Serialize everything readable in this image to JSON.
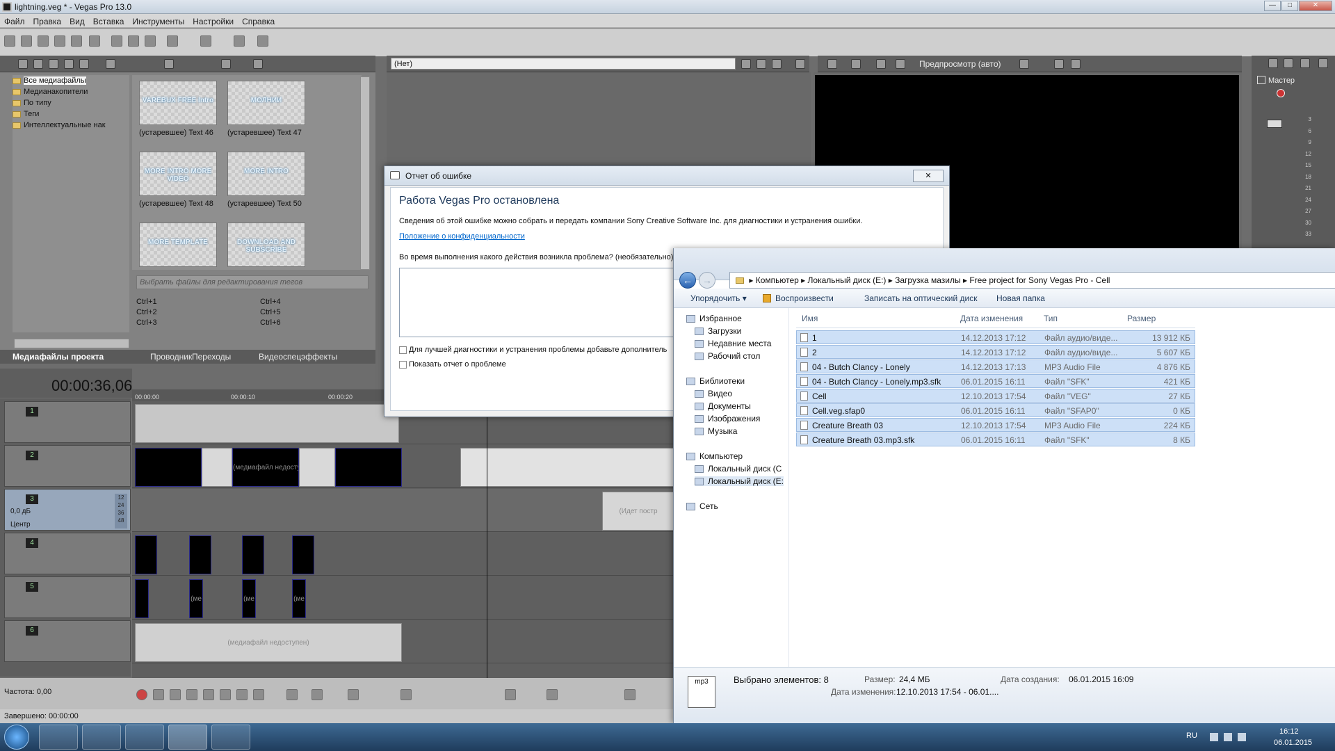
{
  "window": {
    "title": "lightning.veg * - Vegas Pro 13.0",
    "min": "—",
    "max": "□",
    "close": "✕"
  },
  "menu": [
    "Файл",
    "Правка",
    "Вид",
    "Вставка",
    "Инструменты",
    "Настройки",
    "Справка"
  ],
  "media_tree": [
    "Все медиафайлы",
    "Медианакопители",
    "По типу",
    "Теги",
    "Интеллектуальные нак"
  ],
  "thumbnails": [
    {
      "text": "VAREBUX FREE Intro",
      "caption": "(устаревшее) Text 46"
    },
    {
      "text": "МОЛНИИ",
      "caption": "(устаревшее) Text 47"
    },
    {
      "text": "MORE INTRO MORE VIDEO",
      "caption": "(устаревшее) Text 48"
    },
    {
      "text": "MORE INTRO",
      "caption": "(устаревшее) Text 50"
    },
    {
      "text": "MORE TEMPLATE",
      "caption": ""
    },
    {
      "text": "DOWNLOAD AND SUBSCRIBE",
      "caption": ""
    }
  ],
  "tag_placeholder": "Выбрать файлы для редактирования тегов",
  "shortcuts": [
    "Ctrl+1",
    "Ctrl+2",
    "Ctrl+3",
    "Ctrl+4",
    "Ctrl+5",
    "Ctrl+6"
  ],
  "tabs": [
    "Медиафайлы проекта",
    "Проводник",
    "Переходы",
    "Видеоспецэффекты"
  ],
  "fx_select": "(Нет)",
  "preview_label": "Предпросмотр (авто)",
  "mixer_label": "Мастер",
  "mixer_scale": [
    "3",
    "6",
    "9",
    "12",
    "15",
    "18",
    "21",
    "24",
    "27",
    "30",
    "33"
  ],
  "timecode": "00:00:36,06",
  "ruler": [
    "00:00:00",
    "00:00:10",
    "00:00:20"
  ],
  "tracks": [
    "1",
    "2",
    "3",
    "4",
    "5",
    "6"
  ],
  "audio_track": {
    "volume": "0,0 дБ",
    "pan": "Центр",
    "meter": [
      "12",
      "24",
      "36",
      "48"
    ]
  },
  "clip_labels": {
    "unavailable": "(медиафайл недоступен)",
    "building": "(Идет постр",
    "short": "(ме"
  },
  "rate": "Частота: 0,00",
  "status": "Завершено: 00:00:00",
  "dialog": {
    "title": "Отчет об ошибке",
    "heading": "Работа Vegas Pro остановлена",
    "info": "Сведения об этой ошибке можно собрать и передать компании Sony Creative Software Inc. для диагностики и устранения ошибки.",
    "privacy_link": "Положение о конфиденциальности",
    "question": "Во время выполнения какого действия возникла проблема? (необязательно):",
    "check1": "Для лучшей диагностики и устранения проблемы добавьте дополнитель",
    "check2": "Показать отчет о проблеме"
  },
  "explorer": {
    "path": [
      "Компьютер",
      "Локальный диск (E:)",
      "Загрузка мазилы",
      "Free project for Sony Vegas Pro - Cell"
    ],
    "commands": [
      "Упорядочить ▾",
      "Воспроизвести",
      "Записать на оптический диск",
      "Новая папка"
    ],
    "nav": {
      "favorites": "Избранное",
      "fav_items": [
        "Загрузки",
        "Недавние места",
        "Рабочий стол"
      ],
      "libraries": "Библиотеки",
      "lib_items": [
        "Видео",
        "Документы",
        "Изображения",
        "Музыка"
      ],
      "computer": "Компьютер",
      "drives": [
        "Локальный диск (C",
        "Локальный диск (E:"
      ],
      "network": "Сеть"
    },
    "columns": [
      "Имя",
      "Дата изменения",
      "Тип",
      "Размер"
    ],
    "files": [
      {
        "name": "1",
        "date": "14.12.2013 17:12",
        "type": "Файл аудио/виде...",
        "size": "13 912 КБ"
      },
      {
        "name": "2",
        "date": "14.12.2013 17:12",
        "type": "Файл аудио/виде...",
        "size": "5 607 КБ"
      },
      {
        "name": "04 - Butch Clancy - Lonely",
        "date": "14.12.2013 17:13",
        "type": "MP3 Audio File",
        "size": "4 876 КБ"
      },
      {
        "name": "04 - Butch Clancy - Lonely.mp3.sfk",
        "date": "06.01.2015 16:11",
        "type": "Файл \"SFK\"",
        "size": "421 КБ"
      },
      {
        "name": "Cell",
        "date": "12.10.2013 17:54",
        "type": "Файл \"VEG\"",
        "size": "27 КБ"
      },
      {
        "name": "Cell.veg.sfap0",
        "date": "06.01.2015 16:11",
        "type": "Файл \"SFAP0\"",
        "size": "0 КБ"
      },
      {
        "name": "Creature Breath 03",
        "date": "12.10.2013 17:54",
        "type": "MP3 Audio File",
        "size": "224 КБ"
      },
      {
        "name": "Creature Breath 03.mp3.sfk",
        "date": "06.01.2015 16:11",
        "type": "Файл \"SFK\"",
        "size": "8 КБ"
      }
    ],
    "details": {
      "selected": "Выбрано элементов: 8",
      "size_label": "Размер:",
      "size": "24,4 МБ",
      "created_label": "Дата создания:",
      "created": "06.01.2015 16:09",
      "modified_label": "Дата изменения:",
      "modified": "12.10.2013 17:54 - 06.01....",
      "icon_text": "mp3"
    }
  },
  "taskbar": {
    "lang": "RU",
    "time": "16:12",
    "date": "06.01.2015"
  },
  "colors": {
    "selection": "#cde0f7",
    "link": "#0066cc",
    "taskbar": "#2a4d72"
  }
}
